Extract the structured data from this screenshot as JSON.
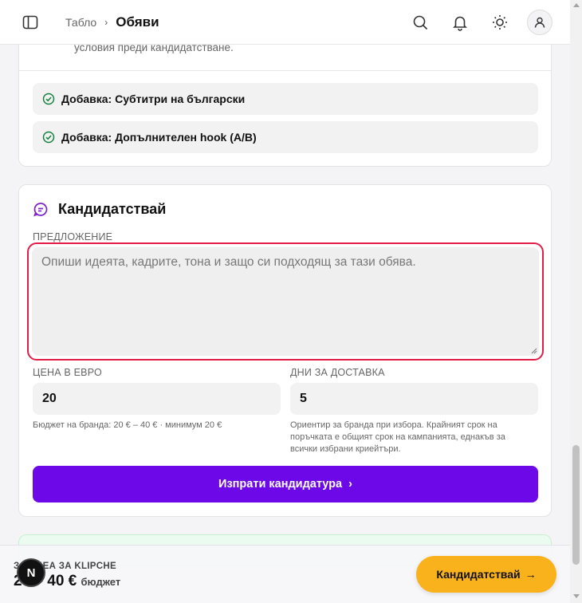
{
  "header": {
    "breadcrumb_prev": "Табло",
    "breadcrumb_sep": "›",
    "breadcrumb_current": "Обяви",
    "icons": [
      "sidebar-toggle-icon",
      "search-icon",
      "bell-icon",
      "sun-icon",
      "user-icon"
    ]
  },
  "requirements": {
    "conditions_text": "условия преди кандидатстване.",
    "addons": [
      "Добавка: Субтитри на български",
      "Добавка: Допълнителен hook (A/B)"
    ]
  },
  "apply": {
    "title": "Кандидатствай",
    "proposal_label": "ПРЕДЛОЖЕНИЕ",
    "proposal_placeholder": "Опиши идеята, кадрите, тона и защо си подходящ за тази обява.",
    "price_label": "ЦЕНА В ЕВРО",
    "price_value": "20",
    "price_hint": "Бюджет на бранда: 20 € – 40 € · минимум 20 €",
    "days_label": "ДНИ ЗА ДОСТАВКА",
    "days_value": "5",
    "days_hint": "Ориентир за бранда при избора. Крайният срок на поръчката е общият срок на кампанията, еднакъв за всички избрани криейтъри.",
    "submit_label": "Изпрати кандидатура",
    "submit_icon": "›"
  },
  "bottom_bar": {
    "label": "ЗА ИДЕА ЗА KLIPCHE",
    "amount": "20 – 40 €",
    "amount_suffix": "бюджет",
    "cta_label": "Кандидатствай",
    "cta_arrow": "→",
    "badge_letter": "N"
  },
  "colors": {
    "accent_purple": "#6d08e8",
    "cta_yellow": "#f9b21c",
    "focus_red": "#e11d48",
    "check_green": "#15803d"
  }
}
